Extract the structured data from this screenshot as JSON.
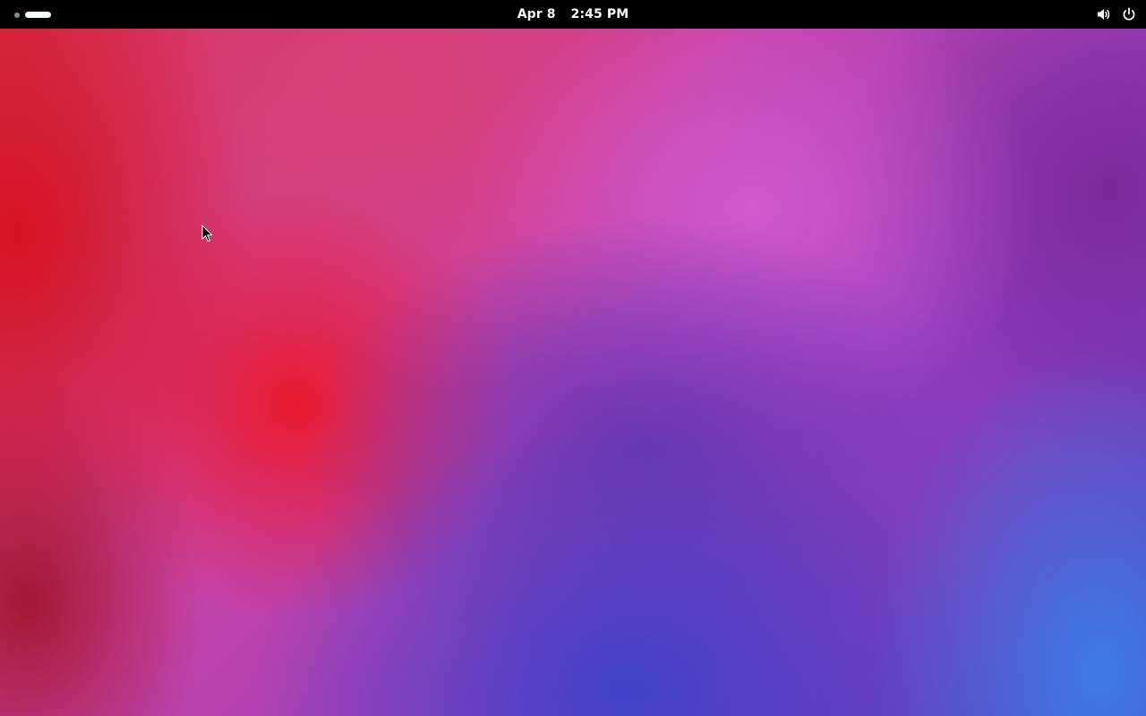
{
  "topbar": {
    "date": "Apr 8",
    "time": "2:45 PM"
  },
  "icons": {
    "volume": "volume-icon",
    "power": "power-icon"
  },
  "colors": {
    "panel": "#000000",
    "panel_text": "#ffffff",
    "workspace_inactive": "#8a8a8a",
    "workspace_active": "#ffffff"
  }
}
